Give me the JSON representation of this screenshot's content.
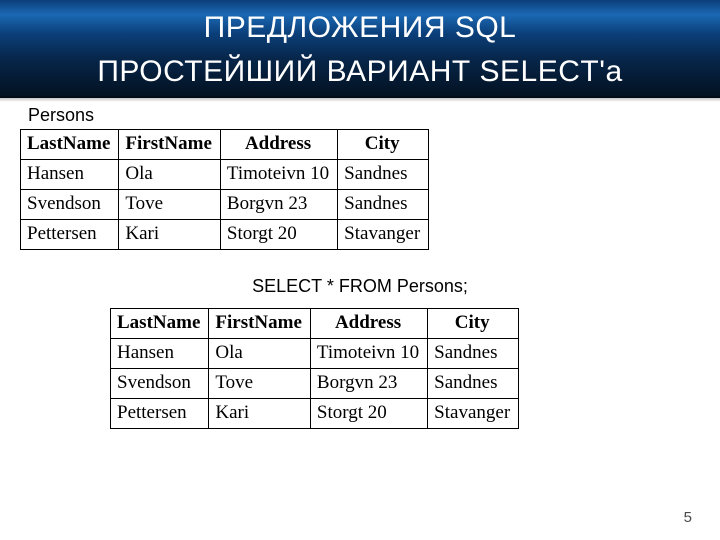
{
  "title_line1": "ПРЕДЛОЖЕНИЯ SQL",
  "title_line2": "ПРОСТЕЙШИЙ ВАРИАНТ SELECT'а",
  "table_caption": "Persons",
  "sql_statement": "SELECT * FROM Persons;",
  "page_number": "5",
  "headers": {
    "last_name": "LastName",
    "first_name": "FirstName",
    "address": "Address",
    "city": "City"
  },
  "rows": [
    {
      "last_name": "Hansen",
      "first_name": "Ola",
      "address": "Timoteivn 10",
      "city": "Sandnes"
    },
    {
      "last_name": "Svendson",
      "first_name": "Tove",
      "address": "Borgvn 23",
      "city": "Sandnes"
    },
    {
      "last_name": "Pettersen",
      "first_name": "Kari",
      "address": "Storgt 20",
      "city": "Stavanger"
    }
  ],
  "chart_data": {
    "type": "table",
    "title": "Persons",
    "columns": [
      "LastName",
      "FirstName",
      "Address",
      "City"
    ],
    "rows": [
      [
        "Hansen",
        "Ola",
        "Timoteivn 10",
        "Sandnes"
      ],
      [
        "Svendson",
        "Tove",
        "Borgvn 23",
        "Sandnes"
      ],
      [
        "Pettersen",
        "Kari",
        "Storgt 20",
        "Stavanger"
      ]
    ]
  }
}
